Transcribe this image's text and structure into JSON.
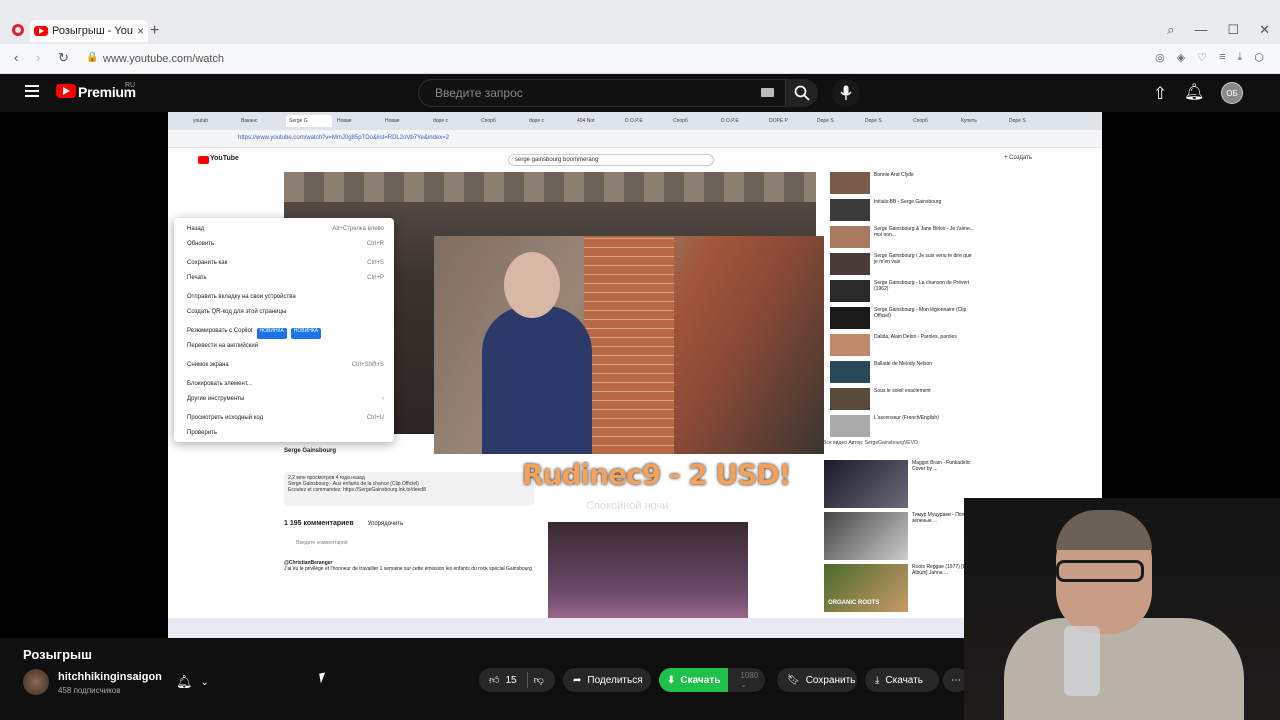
{
  "browser": {
    "tab_title": "Розыгрыш - YouTube",
    "url": "www.youtube.com/watch"
  },
  "masthead": {
    "logo_text": "Premium",
    "logo_region": "RU",
    "search_placeholder": "Введите запрос",
    "account_initials": "ОБ"
  },
  "inner_page": {
    "tabs": [
      "youtub",
      "Ваканс",
      "Serge G",
      "Новая",
      "Новая",
      "dope c",
      "Спорб",
      "dope c",
      "404 Not",
      "D.O.P.E",
      "Спорб",
      "D.O.P.E",
      "DOPE P",
      "Dope S",
      "Dope S",
      "Спорб",
      "Купить",
      "Dope S"
    ],
    "url": "https://www.youtube.com/watch?v=MmJ0g85pTDo&list=RDL2oVb7Ye&index=2",
    "yt_word": "YouTube",
    "search_query": "serge gainsbourg boommerang",
    "create_label": "+ Создать",
    "context_menu": [
      {
        "label": "Назад",
        "shortcut": "Alt+Стрелка влево"
      },
      {
        "label": "Обновить",
        "shortcut": "Ctrl+R"
      },
      {
        "gap": true
      },
      {
        "label": "Сохранить как",
        "shortcut": "Ctrl+S"
      },
      {
        "label": "Печать",
        "shortcut": "Ctrl+P"
      },
      {
        "gap": true
      },
      {
        "label": "Отправить вкладку на свои устройства",
        "shortcut": ""
      },
      {
        "label": "Создать QR-код для этой страницы",
        "shortcut": ""
      },
      {
        "gap": true
      },
      {
        "label": "Резюмировать с Copilot",
        "shortcut": "",
        "badge": "НОВИНКА"
      },
      {
        "label": "Перевести на английский",
        "shortcut": ""
      },
      {
        "gap": true
      },
      {
        "label": "Снимок экрана",
        "shortcut": "Ctrl+Shift+S"
      },
      {
        "gap": true
      },
      {
        "label": "Блокировать элемент...",
        "shortcut": ""
      },
      {
        "label": "Другие инструменты",
        "shortcut": "›"
      },
      {
        "gap": true
      },
      {
        "label": "Просмотреть исходный код",
        "shortcut": "Ctrl+U"
      },
      {
        "label": "Проверить",
        "shortcut": ""
      }
    ],
    "promo_text": "Rudinec9 - 2 USD!",
    "promo_sub": "Спокойной ночи",
    "right_videos": [
      "Bonnie And Clyde",
      "Initials BB - Serge Gainsbourg",
      "Serge Gainsbourg & Jane Birkin - Je t'aime... moi non...",
      "Serge Gainsbourg / Je suis venu te dire que je m'en vais",
      "Serge Gainsbourg - La chanson de Prévert (1962)",
      "Serge Gainsbourg - Mon légionnaire (Clip Officiel)",
      "Dalida, Alain Delon - Paroles, paroles",
      "Ballade de Melody Nelson",
      "Sous le soleil exactement",
      "L'ascenseur (French/English)"
    ],
    "chips": "Все видео   Автор: SergeGainsbourgVEVO",
    "lower_videos": [
      "Maggot Brain - Funkadelic Cover by ...",
      "Тимур Муцураев - Поляны зеленые ...",
      "Roots Reggae (1977) [Lost Album] Jahna ..."
    ],
    "lower_video_tags": [
      "",
      "",
      "ORGANIC ROOTS"
    ],
    "channel": "Serge Gainsbourg",
    "description": "2,2 млн просмотров  4 года назад\nSerge Gainsbourg - Aux enfants de la chance (Clip Officiel)\nEcoutez et commandez: https://SergeGainsbourg.lnk.to/deed8",
    "comments_count": "1 195 комментариев",
    "sort_label": "Упорядочить",
    "comment_input": "Введите комментарий",
    "comment_author": "@ChristianBeranger",
    "comment_text": "J'ai eu le privilège et l'honneur de travailler 1 semaine sur cette émission les enfants du rock spécial Gainsbourg"
  },
  "video": {
    "title": "Розыгрыш",
    "channel": "hitchhikinginsaigon",
    "subscribers": "458 подписчиков",
    "likes": "15",
    "share_label": "Поделиться",
    "download_label": "Скачать",
    "quality": "1080",
    "save_label": "Сохранить",
    "download2_label": "Скачать"
  },
  "icons": [
    "opera-icon",
    "youtube-icon",
    "search-icon",
    "mic-icon",
    "keyboard-icon",
    "upload-icon",
    "bell-icon",
    "menu-icon",
    "like-icon",
    "dislike-icon",
    "share-icon",
    "download-icon",
    "save-icon",
    "more-icon"
  ],
  "colors": {
    "accent": "#ff0000",
    "download_green": "#1ec24a",
    "bg": "#0f0f0f"
  }
}
